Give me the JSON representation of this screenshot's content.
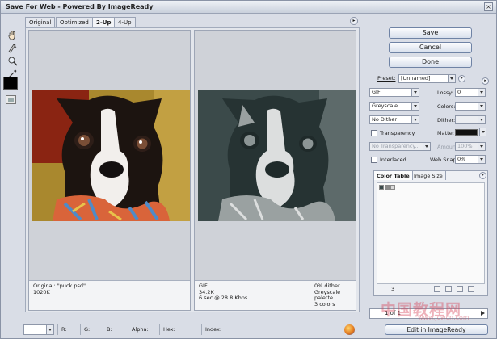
{
  "window": {
    "title": "Save For Web - Powered By ImageReady",
    "close_glyph": "×"
  },
  "tools": [
    "hand-tool-icon",
    "slice-select-tool-icon",
    "zoom-tool-icon",
    "eyedropper-tool-icon"
  ],
  "eyedropper_color": "#000000",
  "tabs": [
    {
      "label": "Original",
      "active": false
    },
    {
      "label": "Optimized",
      "active": false
    },
    {
      "label": "2-Up",
      "active": true
    },
    {
      "label": "4-Up",
      "active": false
    }
  ],
  "panes": {
    "original": {
      "line1": "Original: \"puck.psd\"",
      "line2": "1020K"
    },
    "optimized": {
      "format": "GIF",
      "size": "34.2K",
      "download_time": "6 sec @ 28.8 Kbps",
      "dither_pct": "0% dither",
      "palette": "Greyscale palette",
      "colors": "3 colors"
    }
  },
  "buttons": {
    "save": "Save",
    "cancel": "Cancel",
    "done": "Done",
    "edit_in": "Edit in ImageReady"
  },
  "settings": {
    "preset_label": "Preset:",
    "preset_value": "[Unnamed]",
    "format": "GIF",
    "lossy_label": "Lossy:",
    "lossy_value": "0",
    "reduction": "Greyscale",
    "colors_label": "Colors:",
    "colors_value": "",
    "dither_algo": "No Dither",
    "dither_label": "Dither:",
    "dither_value": "",
    "transparency_label": "Transparency",
    "transparency_checked": false,
    "matte_label": "Matte:",
    "matte_color": "#111111",
    "no_transparency_dither": "No Transparency...",
    "amount_label": "Amount:",
    "amount_value": "100%",
    "interlaced_label": "Interlaced",
    "interlaced_checked": false,
    "websnap_label": "Web Snap:",
    "websnap_value": "0%"
  },
  "color_table": {
    "tabs": [
      "Color Table",
      "Image Size"
    ],
    "swatches": [
      "#3a4a4a",
      "#8a8a8a",
      "#d9d9d9"
    ],
    "count": "3"
  },
  "paging": {
    "text": "1 of 1"
  },
  "status": {
    "r_label": "R:",
    "g_label": "G:",
    "b_label": "B:",
    "alpha_label": "Alpha:",
    "hex_label": "Hex:",
    "index_label": "Index:"
  },
  "watermark": {
    "main": "中国教程网",
    "sub": "www.jcwcn.com"
  }
}
